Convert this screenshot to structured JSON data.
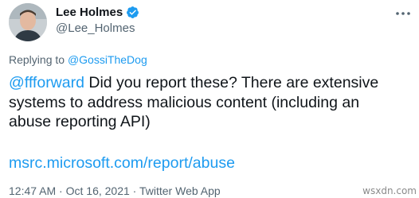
{
  "author": {
    "name": "Lee Holmes",
    "handle": "@Lee_Holmes"
  },
  "replying": {
    "prefix": "Replying to",
    "to": "@GossiTheDog"
  },
  "tweet": {
    "mention": "@ffforward",
    "line1_rest": " Did you report these? There are extensive",
    "line2": "systems to address malicious content (including an",
    "line3": "abuse reporting API)",
    "link": "msrc.microsoft.com/report/abuse"
  },
  "meta": {
    "time": "12:47 AM",
    "separator": "·",
    "date": "Oct 16, 2021",
    "source": "Twitter Web App"
  },
  "watermark": "wsxdn.com",
  "colors": {
    "accent": "#1d9bf0",
    "text": "#0f1419",
    "secondary": "#536471"
  },
  "icons": {
    "verified": "verified-badge-icon",
    "more": "more-options-icon"
  }
}
